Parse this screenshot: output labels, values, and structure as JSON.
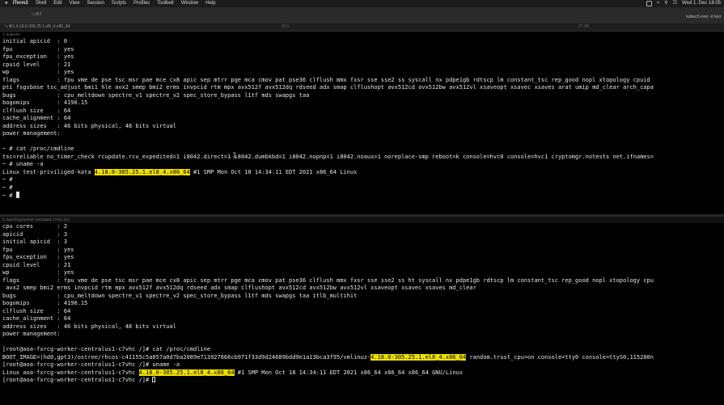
{
  "menubar": {
    "items": [
      "iTerm2",
      "Shell",
      "Edit",
      "View",
      "Session",
      "Scripts",
      "Profiles",
      "Toolbelt",
      "Window",
      "Help"
    ],
    "clock": "Wed 1. Dec 18:05"
  },
  "window": {
    "title_left": "⌥⌘2",
    "title_right": "kubectl exec -it test"
  },
  "tabs": {
    "first": "⌥⌘1 4.18.0-305.25.1.el8_4.x86_64",
    "second": "85%",
    "third": "27.0B"
  },
  "top_pane": {
    "label": "1. kubectl1",
    "lines": [
      "initial apicid  : 0",
      "fpu             : yes",
      "fpu_exception   : yes",
      "cpuid level     : 21",
      "wp              : yes",
      "flags           : fpu vme de pse tsc msr pae mce cx8 apic sep mtrr pge mca cmov pat pse36 clflush mmx fxsr sse sse2 ss syscall nx pdpe1gb rdtscp lm constant_tsc rep_good nopl xtopology cpuid",
      "pti fsgsbase tsc_adjust bmi1 hle avx2 smep bmi2 erms invpcid rtm mpx avx512f avx512dq rdseed adx smap clflushopt avx512cd avx512bw avx512vl xsaveopt xsavec xsaves arat umip md_clear arch_capa",
      "bugs            : cpu_meltdown spectre_v1 spectre_v2 spec_store_bypass l1tf mds swapgs taa",
      "bogomips        : 4190.15",
      "clflush size    : 64",
      "cache_alignment : 64",
      "address sizes   : 46 bits physical, 48 bits virtual",
      "power management:",
      "",
      "~ # cat /proc/cmdline",
      "tsc=reliable no_timer_check rcupdate.rcu_expedited=1 i8042.direct=1 i8042.dumbkbd=1 i8042.nopnp=1 i8042.noaux=1 noreplace-smp reboot=k console=hvc0 console=hvc1 cryptomgr.notests net.ifnames=",
      "~ # uname -a"
    ],
    "uname_prefix": "Linux test-priviliged-kata ",
    "kernel": "4.18.0-305.25.1.el8_4.x86_64",
    "uname_suffix": " #1 SMP Mon Oct 18 14:34:11 EDT 2021 x86_64 Linux",
    "prompt1": "~ #",
    "prompt2": "~ #",
    "prompt3": "~ # "
  },
  "bottom_pane": {
    "label": "2. aoa-fxrcg-worker-centralus1-c7vhc (oc)",
    "lines": [
      "cpu cores       : 2",
      "apicid          : 3",
      "initial apicid  : 3",
      "fpu             : yes",
      "fpu_exception   : yes",
      "cpuid level     : 21",
      "wp              : yes",
      "flags           : fpu vme de pse tsc msr pae mce cx8 apic sep mtrr pge mca cmov pat pse36 clflush mmx fxsr sse sse2 ss ht syscall nx pdpe1gb rdtscp lm constant_tsc rep_good nopl xtopology cpu",
      " avx2 smep bmi2 erms invpcid rtm mpx avx512f avx512dq rdseed adx smap clflushopt avx512cd avx512bw avx512vl xsaveopt xsavec xsaves md_clear",
      "bugs            : cpu_meltdown spectre_v1 spectre_v2 spec_store_bypass l1tf mds swapgs taa itlb_multihit",
      "bogomips        : 4190.15",
      "clflush size    : 64",
      "cache_alignment : 64",
      "address sizes   : 46 bits physical, 48 bits virtual",
      "power management:",
      "",
      "[root@aoa-fxrcg-worker-centralus1-c7vhc /]# cat /proc/cmdline"
    ],
    "boot_prefix": "BOOT_IMAGE=(hd0,gpt3)/ostree/rhcos-c41155c5a057a0d7ba2089e713927666cb971f33d9d24689bdd9e1a13bca3f95/vmlinuz-",
    "kernel": "4.18.0-305.25.1.el8_4.x86_64",
    "boot_suffix": " random.trust_cpu=on console=tty0 console=ttyS0,115200n",
    "uname_cmd": "[root@aoa-fxrcg-worker-centralus1-c7vhc /]# uname -a",
    "uname_prefix": "Linux aoa-fxrcg-worker-centralus1-c7vhc ",
    "uname_suffix": " #1 SMP Mon Oct 18 14:34:11 EDT 2021 x86_64 x86_64 x86_64 GNU/Linux",
    "final_prompt": "[root@aoa-fxrcg-worker-centralus1-c7vhc /]# "
  }
}
